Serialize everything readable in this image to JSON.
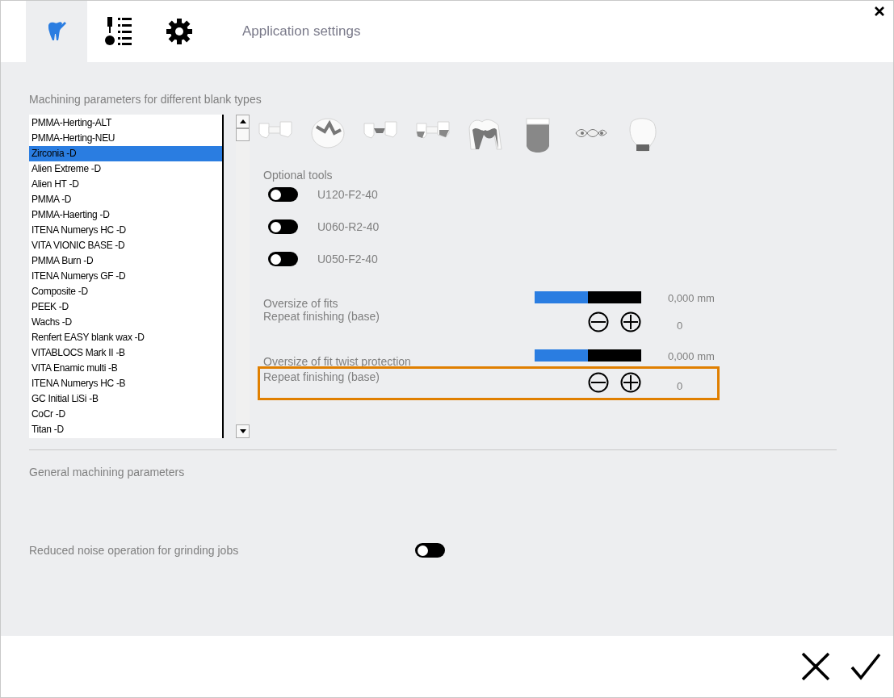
{
  "header": {
    "tabs": [
      {
        "kind": "tooth",
        "selected": true
      },
      {
        "kind": "list",
        "selected": false
      },
      {
        "kind": "gear",
        "selected": false
      }
    ],
    "title": "Application settings"
  },
  "blank_section": {
    "title": "Machining parameters for different blank types",
    "blanks": [
      {
        "label": "PMMA-Herting-ALT",
        "selected": false
      },
      {
        "label": "PMMA-Herting-NEU",
        "selected": false
      },
      {
        "label": "Zirconia -D",
        "selected": true
      },
      {
        "label": "Alien Extreme -D",
        "selected": false
      },
      {
        "label": "Alien HT -D",
        "selected": false
      },
      {
        "label": "PMMA -D",
        "selected": false
      },
      {
        "label": "PMMA-Haerting -D",
        "selected": false
      },
      {
        "label": "ITENA Numerys HC -D",
        "selected": false
      },
      {
        "label": "VITA VIONIC BASE -D",
        "selected": false
      },
      {
        "label": "PMMA Burn -D",
        "selected": false
      },
      {
        "label": "ITENA Numerys GF -D",
        "selected": false
      },
      {
        "label": "Composite -D",
        "selected": false
      },
      {
        "label": "PEEK -D",
        "selected": false
      },
      {
        "label": "Wachs -D",
        "selected": false
      },
      {
        "label": "Renfert EASY blank wax -D",
        "selected": false
      },
      {
        "label": "VITABLOCS Mark II -B",
        "selected": false
      },
      {
        "label": "VITA Enamic multi -B",
        "selected": false
      },
      {
        "label": "ITENA Numerys HC -B",
        "selected": false
      },
      {
        "label": "GC Initial LiSi -B",
        "selected": false
      },
      {
        "label": "CoCr -D",
        "selected": false
      },
      {
        "label": "Titan -D",
        "selected": false
      }
    ],
    "optional_tools": {
      "title": "Optional tools",
      "tools": [
        {
          "label": "U120-F2-40",
          "on": false
        },
        {
          "label": "U060-R2-40",
          "on": false
        },
        {
          "label": "U050-F2-40",
          "on": false
        }
      ]
    },
    "parameters": [
      {
        "kind": "slider",
        "label": "Oversize of fits",
        "level": 0.5,
        "value": "0,000 mm",
        "highlighted": false
      },
      {
        "kind": "stepper",
        "label": "Repeat finishing (base)",
        "value": "0",
        "highlighted": false
      },
      {
        "kind": "slider",
        "label": "Oversize of fit twist protection",
        "level": 0.5,
        "value": "0,000 mm",
        "highlighted": false
      },
      {
        "kind": "stepper",
        "label": "Repeat finishing (base)",
        "value": "0",
        "highlighted": true
      }
    ]
  },
  "general_section": {
    "title": "General machining parameters",
    "settings": [
      {
        "label": "Reduced noise operation for grinding jobs",
        "on": false
      }
    ]
  }
}
